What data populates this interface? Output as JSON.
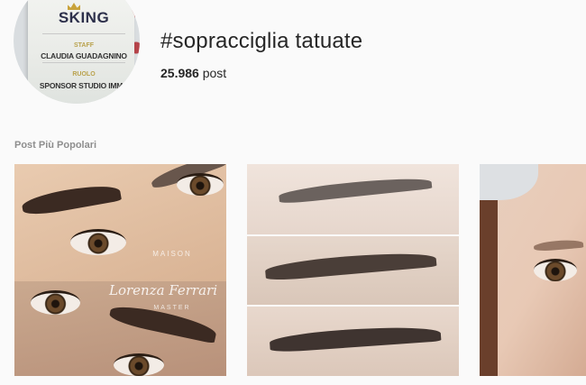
{
  "header": {
    "avatar": {
      "brand": "SKING",
      "staff_label": "STAFF",
      "staff_name": "CLAUDIA GUADAGNINO",
      "role_label": "RUOLO",
      "role_value": "SPONSOR STUDIO IMMA"
    },
    "hashtag": "#sopracciglia tatuate",
    "post_count": "25.986",
    "post_label": "post"
  },
  "section_title": "Post Più Popolari",
  "posts": [
    {
      "watermark_top": "MAISON",
      "watermark_name": "Lorenza Ferrari",
      "watermark_bottom": "MASTER"
    },
    {},
    {}
  ]
}
